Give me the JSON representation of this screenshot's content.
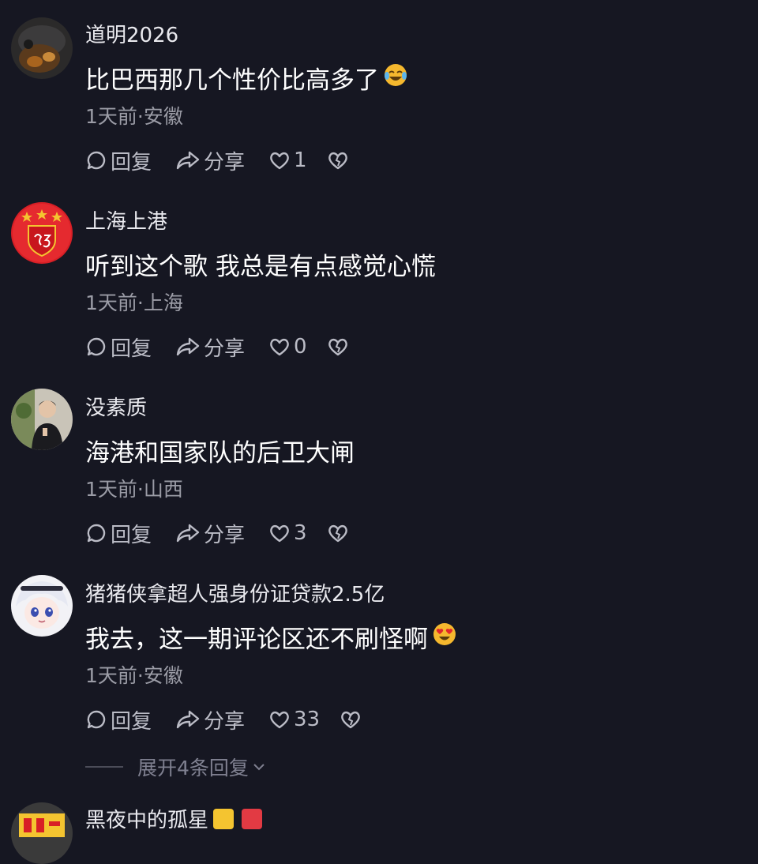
{
  "comments": [
    {
      "username": "道明2026",
      "text": "比巴西那几个性价比高多了",
      "emoji": "laugh-cry-emoji",
      "meta": "1天前·安徽",
      "reply_label": "回复",
      "share_label": "分享",
      "likes": "1"
    },
    {
      "username": "上海上港",
      "text": "听到这个歌 我总是有点感觉心慌",
      "meta": "1天前·上海",
      "reply_label": "回复",
      "share_label": "分享",
      "likes": "0"
    },
    {
      "username": "没素质",
      "text": "海港和国家队的后卫大闸",
      "meta": "1天前·山西",
      "reply_label": "回复",
      "share_label": "分享",
      "likes": "3"
    },
    {
      "username": "猪猪侠拿超人强身份证贷款2.5亿",
      "text": "我去，这一期评论区还不刷怪啊",
      "emoji": "heart-eyes-emoji",
      "meta": "1天前·安徽",
      "reply_label": "回复",
      "share_label": "分享",
      "likes": "33"
    },
    {
      "username": "黑夜中的孤星"
    }
  ],
  "expand_replies": "展开4条回复",
  "colors": {
    "background": "#161722",
    "meta_text": "#9b9ca6",
    "action_text": "#bbbcc6"
  }
}
